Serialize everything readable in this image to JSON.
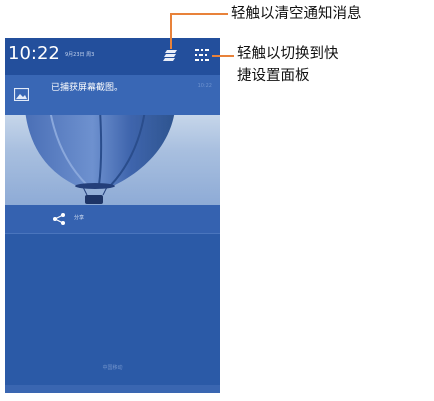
{
  "status_bar": {
    "time": "10:22",
    "date": "9月23日 周3",
    "clear_icon": "clear-notifications-icon",
    "settings_icon": "quick-settings-toggle-icon"
  },
  "notification": {
    "title": "已捕获屏幕截图。",
    "time": "10:22",
    "icon": "image-icon"
  },
  "share": {
    "label": "分享",
    "icon": "share-icon"
  },
  "footer": {
    "carrier": "中国移动"
  },
  "callouts": {
    "clear": "轻触以清空通知消息",
    "settings_line1": "轻触以切换到快",
    "settings_line2": "捷设置面板"
  },
  "colors": {
    "panel": "#2b5aa7",
    "accent_line": "#e8823a"
  }
}
